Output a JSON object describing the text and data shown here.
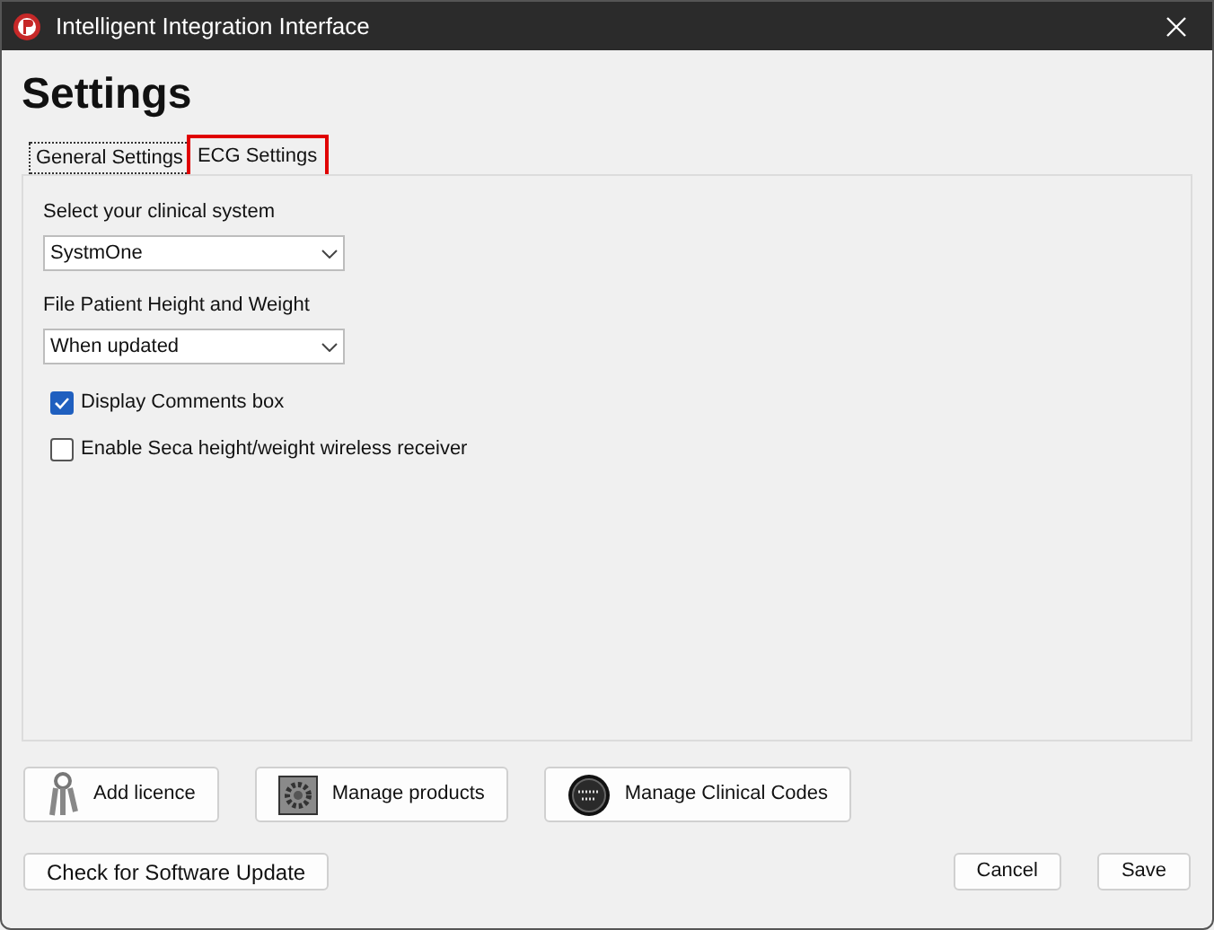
{
  "window": {
    "title": "Intelligent Integration Interface"
  },
  "heading": "Settings",
  "tabs": [
    {
      "label": "General Settings",
      "selected": true,
      "highlighted": false
    },
    {
      "label": "ECG Settings",
      "selected": false,
      "highlighted": true
    }
  ],
  "fields": [
    {
      "label": "Select your clinical system",
      "value": "SystmOne"
    },
    {
      "label": "File Patient Height and Weight",
      "value": "When updated"
    }
  ],
  "checkboxes": [
    {
      "label": "Display Comments box",
      "checked": true
    },
    {
      "label": "Enable Seca height/weight wireless receiver",
      "checked": false
    }
  ],
  "tool_buttons": [
    {
      "label": "Add licence",
      "kind": "keys"
    },
    {
      "label": "Manage products",
      "kind": "gear"
    },
    {
      "label": "Manage Clinical Codes",
      "kind": "disc"
    }
  ],
  "update_button": "Check for Software Update",
  "buttons": [
    "Cancel",
    "Save"
  ]
}
